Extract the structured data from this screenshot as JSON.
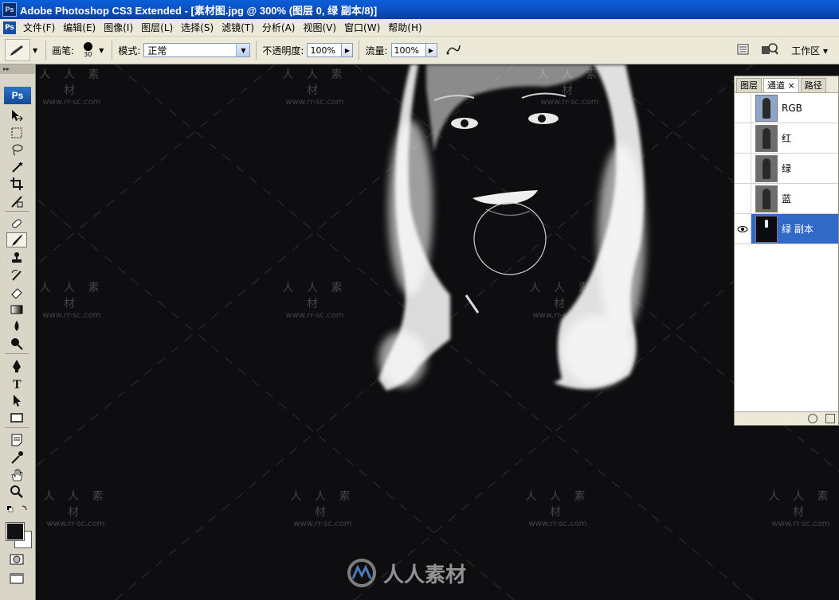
{
  "window": {
    "title": "Adobe Photoshop CS3 Extended - [素材图.jpg @ 300% (图层 0, 绿 副本/8)]",
    "app_icon_text": "Ps"
  },
  "menu": {
    "icon_text": "Ps",
    "items": [
      "文件(F)",
      "编辑(E)",
      "图像(I)",
      "图层(L)",
      "选择(S)",
      "滤镜(T)",
      "分析(A)",
      "视图(V)",
      "窗口(W)",
      "帮助(H)"
    ]
  },
  "options": {
    "brush_label": "画笔:",
    "brush_size": "30",
    "mode_label": "模式:",
    "mode_value": "正常",
    "opacity_label": "不透明度:",
    "opacity_value": "100%",
    "flow_label": "流量:",
    "flow_value": "100%",
    "workspace_label": "工作区 ▾"
  },
  "toolbox": {
    "logo_text": "Ps",
    "tools": [
      "move-icon",
      "marquee-icon",
      "lasso-icon",
      "magic-wand-icon",
      "crop-icon",
      "slice-icon",
      "healing-brush-icon",
      "brush-icon",
      "clone-stamp-icon",
      "history-brush-icon",
      "eraser-icon",
      "gradient-icon",
      "blur-icon",
      "dodge-icon",
      "pen-icon",
      "type-icon",
      "path-selection-icon",
      "rectangle-icon",
      "notes-icon",
      "eyedropper-icon",
      "hand-icon",
      "zoom-icon"
    ],
    "foreground_color": "#111111",
    "background_color": "#ffffff"
  },
  "canvas": {
    "background": "#0e0e10",
    "watermark_cn": "人 人 素 材",
    "watermark_url": "www.rr-sc.com",
    "brand_watermark": "人人素材",
    "brush_cursor_visible": true
  },
  "panel": {
    "tabs": [
      "图层",
      "通道 ×",
      "路径"
    ],
    "active_tab_index": 1,
    "channels": [
      {
        "name": "RGB",
        "visible": false,
        "selected": false
      },
      {
        "name": "红",
        "visible": false,
        "selected": false
      },
      {
        "name": "绿",
        "visible": false,
        "selected": false
      },
      {
        "name": "蓝",
        "visible": false,
        "selected": false
      },
      {
        "name": "绿 副本",
        "visible": true,
        "selected": true
      }
    ]
  }
}
